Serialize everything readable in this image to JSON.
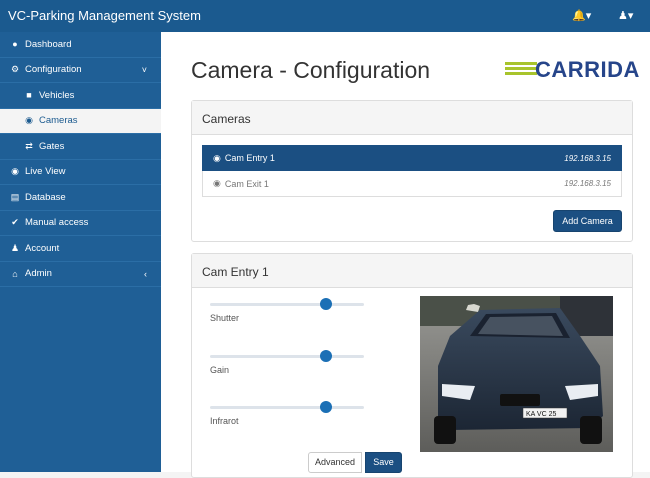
{
  "app": {
    "title": "VC-Parking Management System"
  },
  "topbar": {
    "notifications_icon": "bell-icon",
    "user_icon": "user-icon"
  },
  "sidebar": {
    "items": [
      {
        "label": "Dashboard",
        "icon": "dashboard-icon"
      },
      {
        "label": "Configuration",
        "icon": "gear-icon"
      },
      {
        "label": "Vehicles",
        "icon": "car-icon"
      },
      {
        "label": "Cameras",
        "icon": "camera-icon"
      },
      {
        "label": "Gates",
        "icon": "exchange-icon"
      },
      {
        "label": "Live View",
        "icon": "eye-icon"
      },
      {
        "label": "Database",
        "icon": "database-icon"
      },
      {
        "label": "Manual access",
        "icon": "wrench-icon"
      },
      {
        "label": "Account",
        "icon": "user-icon"
      },
      {
        "label": "Admin",
        "icon": "home-icon"
      }
    ],
    "active": "Cameras"
  },
  "main": {
    "page_title": "Camera - Configuration",
    "logo_text": "CARRIDA"
  },
  "cameras_panel": {
    "title": "Cameras",
    "cameras": [
      {
        "name": "Cam Entry 1",
        "ip": "192.168.3.15",
        "selected": true
      },
      {
        "name": "Cam Exit 1",
        "ip": "192.168.3.15",
        "selected": false
      }
    ],
    "add_button": "Add Camera"
  },
  "settings_panel": {
    "title": "Cam Entry 1",
    "sliders": [
      {
        "label": "Shutter",
        "value": 0.75
      },
      {
        "label": "Gain",
        "value": 0.75
      },
      {
        "label": "Infrarot",
        "value": 0.75
      }
    ],
    "advanced_button": "Advanced",
    "save_button": "Save",
    "image": {
      "plate_text": "KA VC 25"
    }
  },
  "colors": {
    "topbar": "#1b5a8f",
    "sidebar": "#1f5f96",
    "accent": "#1b4f82",
    "logo_green": "#a8c42c",
    "logo_blue": "#26458a"
  }
}
